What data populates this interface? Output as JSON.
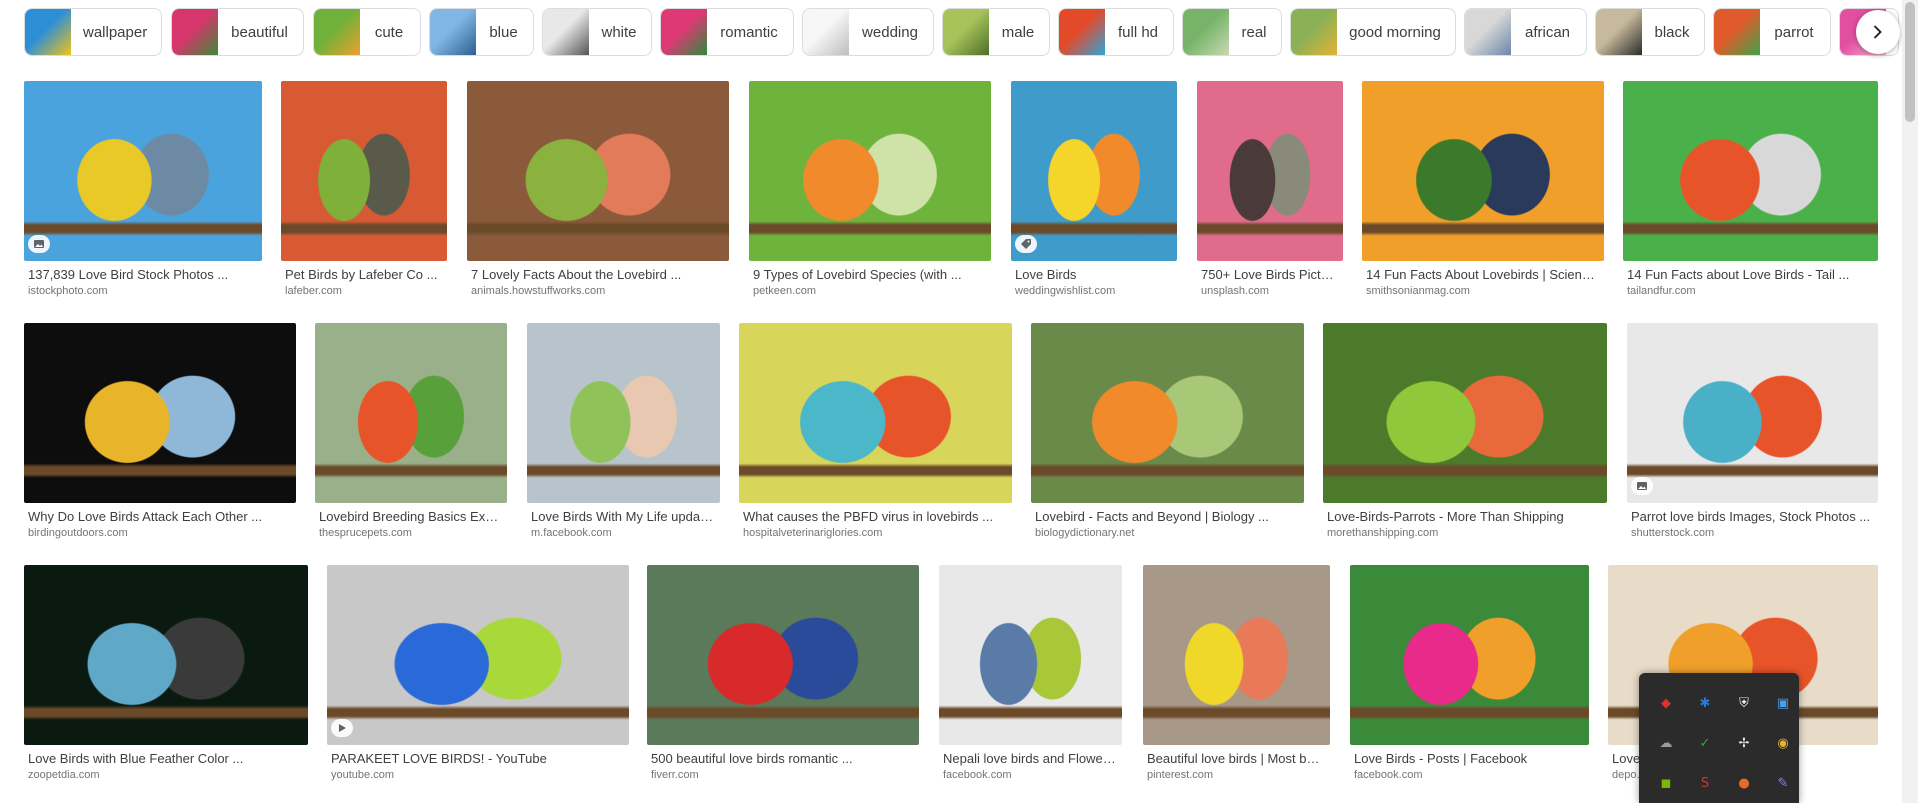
{
  "chips": [
    {
      "label": "wallpaper",
      "colors": [
        "#2f8fd6",
        "#f2c318"
      ]
    },
    {
      "label": "beautiful",
      "colors": [
        "#d6366b",
        "#3d8a3a"
      ]
    },
    {
      "label": "cute",
      "colors": [
        "#6fb13a",
        "#f0a02c"
      ]
    },
    {
      "label": "blue",
      "colors": [
        "#7fb6e3",
        "#2d5e92"
      ]
    },
    {
      "label": "white",
      "colors": [
        "#e8e8e8",
        "#555555"
      ]
    },
    {
      "label": "romantic",
      "colors": [
        "#e03874",
        "#2e8a3b"
      ]
    },
    {
      "label": "wedding",
      "colors": [
        "#f7f7f7",
        "#bdbdbd"
      ]
    },
    {
      "label": "male",
      "colors": [
        "#a8c35a",
        "#4d6e2b"
      ]
    },
    {
      "label": "full hd",
      "colors": [
        "#e24a2a",
        "#2fa4d8"
      ]
    },
    {
      "label": "real",
      "colors": [
        "#77b46a",
        "#c9d9b3"
      ]
    },
    {
      "label": "good morning",
      "colors": [
        "#8ab155",
        "#e3b336"
      ]
    },
    {
      "label": "african",
      "colors": [
        "#d8d8d8",
        "#6b87a8"
      ]
    },
    {
      "label": "black",
      "colors": [
        "#c7b99c",
        "#2c2c2c"
      ]
    },
    {
      "label": "parrot",
      "colors": [
        "#e05a2c",
        "#3ca54a"
      ]
    },
    {
      "label": "",
      "colors": [
        "#e34fa0",
        "#f3b4d6"
      ]
    }
  ],
  "accessibility": {
    "next_arrow": "Next"
  },
  "results": {
    "row1": [
      {
        "caption": "137,839 Love Bird Stock Photos ...",
        "source": "istockphoto.com",
        "colors": [
          "#4aa3dc",
          "#e9c928",
          "#6c8aa3"
        ],
        "badge": "image"
      },
      {
        "caption": "Pet Birds by Lafeber Co ...",
        "source": "lafeber.com",
        "colors": [
          "#d75a34",
          "#7fb03a",
          "#5a5a4a"
        ]
      },
      {
        "caption": "7 Lovely Facts About the Lovebird ...",
        "source": "animals.howstuffworks.com",
        "colors": [
          "#8a5a3a",
          "#8bb23f",
          "#e27b5a"
        ]
      },
      {
        "caption": "9 Types of Lovebird Species (with ...",
        "source": "petkeen.com",
        "colors": [
          "#6eb33b",
          "#f08a2a",
          "#cfe3a8"
        ]
      },
      {
        "caption": "Love Birds",
        "source": "weddingwishlist.com",
        "colors": [
          "#3f9bc9",
          "#f5d52a",
          "#f08a2a"
        ],
        "badge": "tag"
      },
      {
        "caption": "750+ Love Birds Pictur...",
        "source": "unsplash.com",
        "colors": [
          "#e06b8b",
          "#4a3a3a",
          "#8a8a7a"
        ]
      },
      {
        "caption": "14 Fun Facts About Lovebirds | Science ...",
        "source": "smithsonianmag.com",
        "colors": [
          "#f0a02a",
          "#3a7a2a",
          "#2a3a5a"
        ]
      },
      {
        "caption": "14 Fun Facts about Love Birds - Tail ...",
        "source": "tailandfur.com",
        "colors": [
          "#4ab04a",
          "#e8542a",
          "#d8d8d8"
        ]
      }
    ],
    "row2": [
      {
        "caption": "Why Do Love Birds Attack Each Other ...",
        "source": "birdingoutdoors.com",
        "colors": [
          "#0d0d0d",
          "#e8b42a",
          "#8fb7d8"
        ]
      },
      {
        "caption": "Lovebird Breeding Basics Explai...",
        "source": "thesprucepets.com",
        "colors": [
          "#9ab08a",
          "#e8542a",
          "#58a03a"
        ]
      },
      {
        "caption": "Love Birds With My Life update...",
        "source": "m.facebook.com",
        "colors": [
          "#b8c4cc",
          "#8fc35a",
          "#e8c8b0"
        ]
      },
      {
        "caption": "What causes the PBFD virus in lovebirds ...",
        "source": "hospitalveterinariglories.com",
        "colors": [
          "#d8d65a",
          "#4ab8c8",
          "#e8542a"
        ]
      },
      {
        "caption": "Lovebird - Facts and Beyond | Biology ...",
        "source": "biologydictionary.net",
        "colors": [
          "#6a8a4a",
          "#f08a2a",
          "#a8c878"
        ]
      },
      {
        "caption": "Love-Birds-Parrots - More Than Shipping",
        "source": "morethanshipping.com",
        "colors": [
          "#4a7a2a",
          "#8fc83a",
          "#e86a3a"
        ]
      },
      {
        "caption": "Parrot love birds Images, Stock Photos ...",
        "source": "shutterstock.com",
        "colors": [
          "#e8e8e8",
          "#4ab0c8",
          "#e8542a"
        ],
        "badge": "image"
      }
    ],
    "row3": [
      {
        "caption": "Love Birds with Blue Feather Color ...",
        "source": "zoopetdia.com",
        "colors": [
          "#0a1a10",
          "#5fa8c8",
          "#3a3a3a"
        ]
      },
      {
        "caption": "PARAKEET LOVE BIRDS! - YouTube",
        "source": "youtube.com",
        "colors": [
          "#c8c8c8",
          "#2a6ad8",
          "#a8d83a"
        ],
        "badge": "play"
      },
      {
        "caption": "500 beautiful love birds romantic ...",
        "source": "fiverr.com",
        "colors": [
          "#5a7a5a",
          "#d82a2a",
          "#2a4a9a"
        ]
      },
      {
        "caption": "Nepali love birds and Flower h...",
        "source": "facebook.com",
        "colors": [
          "#e8e8e8",
          "#5a7aa8",
          "#a8c83a"
        ]
      },
      {
        "caption": "Beautiful love birds | Most bea...",
        "source": "pinterest.com",
        "colors": [
          "#a89888",
          "#f0d82a",
          "#e87a5a"
        ]
      },
      {
        "caption": "Love Birds - Posts | Facebook",
        "source": "facebook.com",
        "colors": [
          "#3a8a3a",
          "#e82a8a",
          "#f0a02a"
        ]
      },
      {
        "caption": "Love ... photo ...",
        "source": "depo...",
        "colors": [
          "#e8dcc8",
          "#f0a02a",
          "#e8542a"
        ]
      }
    ]
  },
  "tray": {
    "icons": [
      {
        "name": "antivirus-shield-icon",
        "glyph": "◆",
        "color": "#d8342a"
      },
      {
        "name": "bluetooth-icon",
        "glyph": "✱",
        "color": "#2a7ad8"
      },
      {
        "name": "security-shield-icon",
        "glyph": "⛨",
        "color": "#f0f0f0"
      },
      {
        "name": "network-monitor-icon",
        "glyph": "▣",
        "color": "#4aa0e8"
      },
      {
        "name": "cloud-offline-icon",
        "glyph": "☁",
        "color": "#9a9a9a"
      },
      {
        "name": "check-shield-icon",
        "glyph": "✓",
        "color": "#3aa83a"
      },
      {
        "name": "pinwheel-icon",
        "glyph": "✢",
        "color": "#e8e8e8"
      },
      {
        "name": "chrome-icon",
        "glyph": "◉",
        "color": "#e8b42a"
      },
      {
        "name": "nvidia-icon",
        "glyph": "◼",
        "color": "#76b900"
      },
      {
        "name": "s-app-icon",
        "glyph": "S",
        "color": "#d8342a"
      },
      {
        "name": "firefox-icon",
        "glyph": "●",
        "color": "#e86a2a"
      },
      {
        "name": "pen-tool-icon",
        "glyph": "✎",
        "color": "#9a7ad8"
      }
    ]
  }
}
